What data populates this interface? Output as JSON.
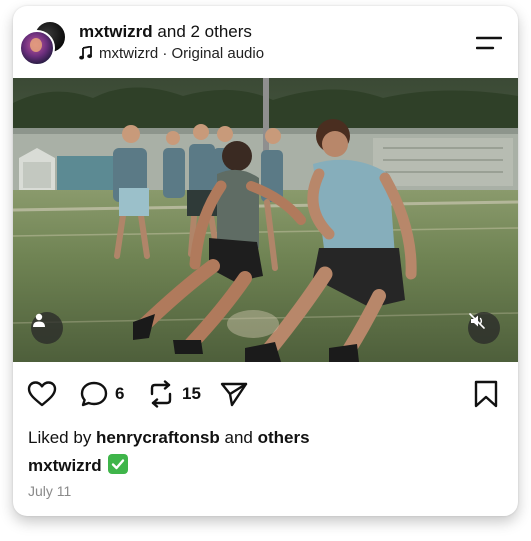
{
  "header": {
    "username": "mxtwizrd",
    "collab_text": " and 2 others",
    "audio_text": "mxtwizrd · Original audio"
  },
  "actions": {
    "comments_count": "6",
    "reposts_count": "15"
  },
  "likes": {
    "prefix": "Liked by ",
    "user": "henrycraftonsb",
    "middle": " and ",
    "others": "others"
  },
  "caption": {
    "author": "mxtwizrd"
  },
  "date": "July 11",
  "colors": {
    "verified": "#3fb54a",
    "field_green": "#6b7d55"
  }
}
